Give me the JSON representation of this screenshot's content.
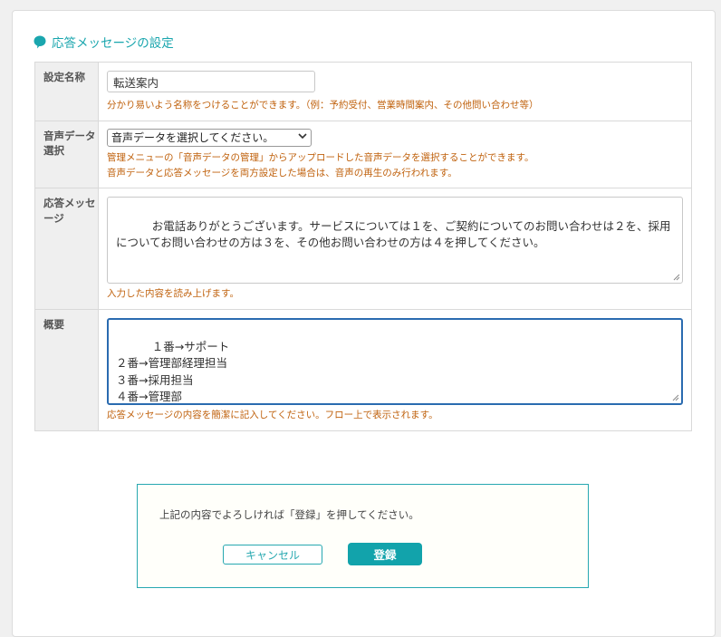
{
  "section_title": "応答メッセージの設定",
  "fields": {
    "name": {
      "label": "設定名称",
      "value": "転送案内",
      "hint": "分かり易いよう名称をつけることができます。（例：予約受付、営業時間案内、その他問い合わせ等）"
    },
    "audio": {
      "label": "音声データ選択",
      "selected": "音声データを選択してください。",
      "hint1": "管理メニューの「音声データの管理」からアップロードした音声データを選択することができます。",
      "hint2": "音声データと応答メッセージを両方設定した場合は、音声の再生のみ行われます。"
    },
    "message": {
      "label": "応答メッセージ",
      "value": "お電話ありがとうございます。サービスについては１を、ご契約についてのお問い合わせは２を、採用についてお問い合わせの方は３を、その他お問い合わせの方は４を押してください。",
      "hint": "入力した内容を読み上げます。"
    },
    "summary": {
      "label": "概要",
      "value": "１番→サポート\n２番→管理部経理担当\n３番→採用担当\n４番→管理部",
      "hint": "応答メッセージの内容を簡潔に記入してください。フロー上で表示されます。"
    }
  },
  "confirm": {
    "message": "上記の内容でよろしければ「登録」を押してください。",
    "cancel_label": "キャンセル",
    "register_label": "登録"
  },
  "colors": {
    "accent": "#12a3ab",
    "hint": "#c0620e",
    "focus": "#2a6bb0"
  }
}
